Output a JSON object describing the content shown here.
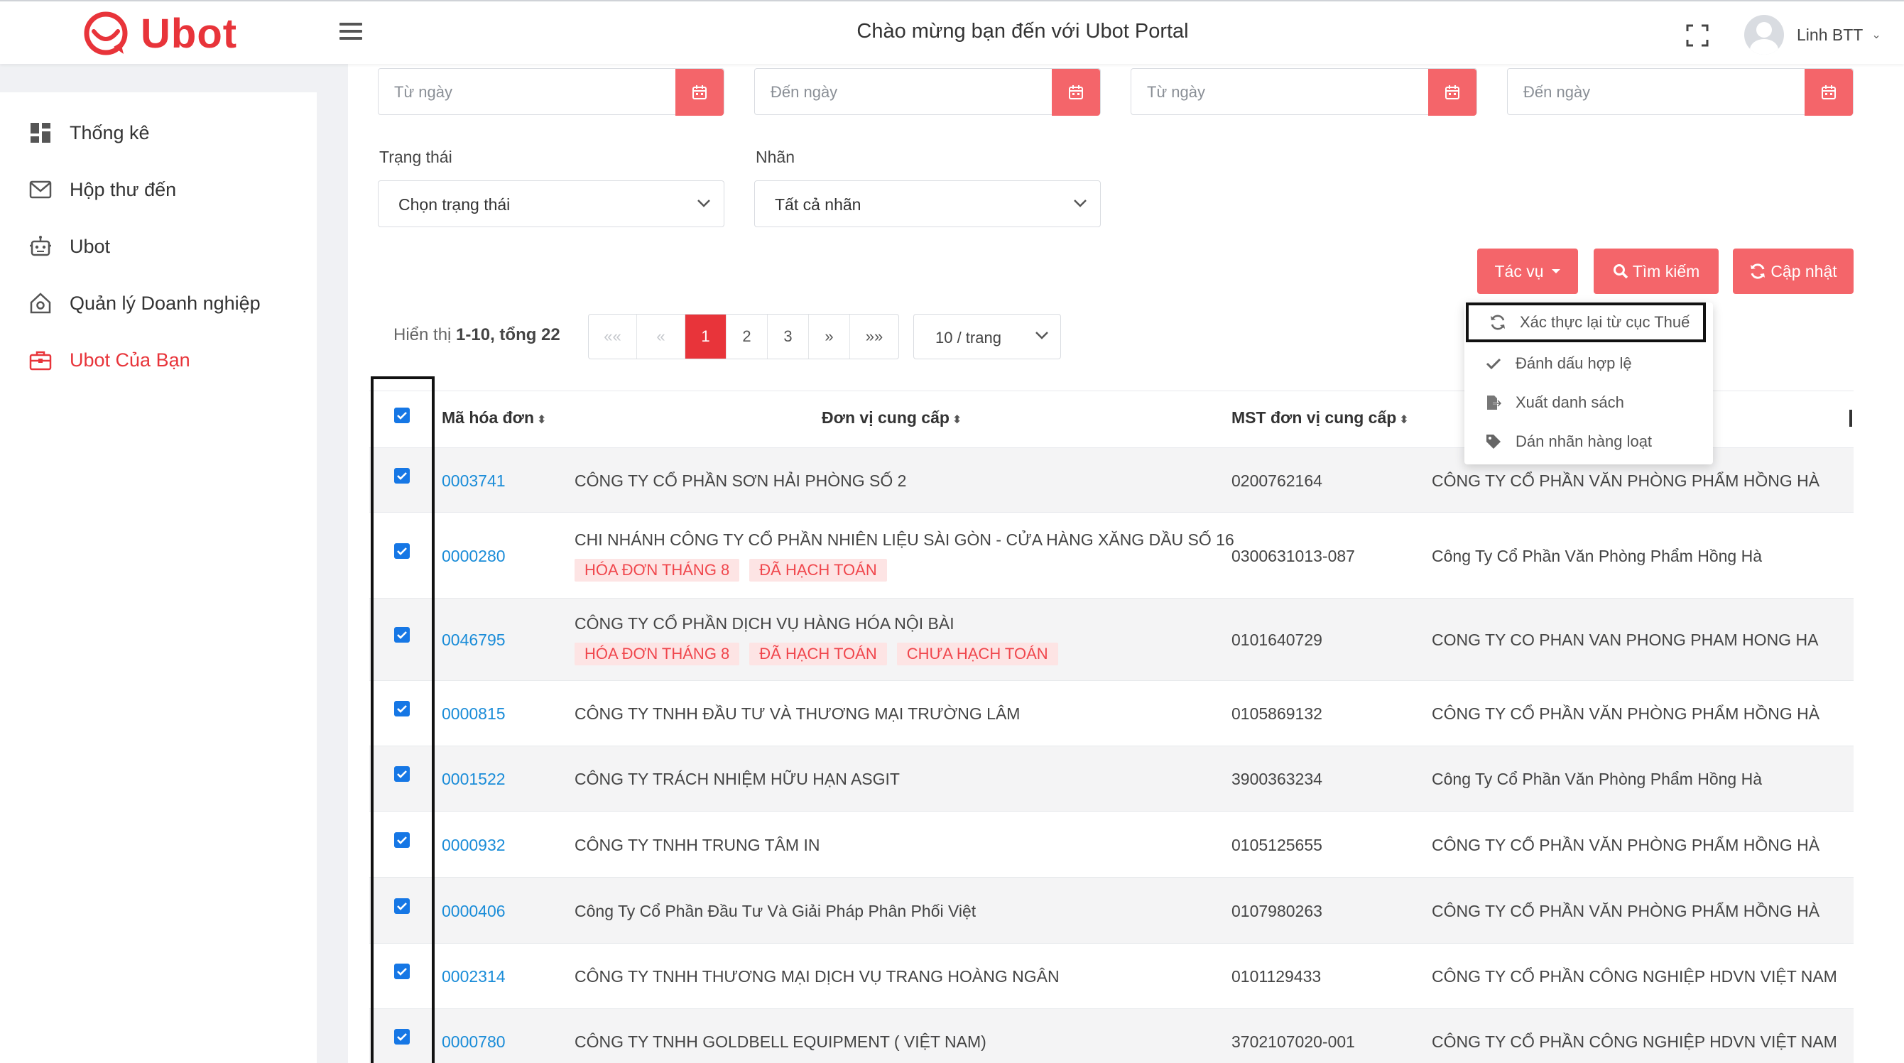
{
  "header": {
    "brand": "Ubot",
    "title": "Chào mừng bạn đến với Ubot Portal",
    "user_name": "Linh BTT",
    "user_caret": "⌄"
  },
  "sidebar": {
    "items": [
      {
        "label": "Thống kê",
        "icon": "dashboard-icon"
      },
      {
        "label": "Hộp thư đến",
        "icon": "mail-icon"
      },
      {
        "label": "Ubot",
        "icon": "robot-icon"
      },
      {
        "label": "Quản lý Doanh nghiệp",
        "icon": "building-icon"
      },
      {
        "label": "Ubot Của Bạn",
        "icon": "briefcase-icon",
        "active": true
      }
    ]
  },
  "filters": {
    "dates": [
      "Từ ngày",
      "Đến ngày",
      "Từ ngày",
      "Đến ngày"
    ],
    "status_label": "Trạng thái",
    "status_value": "Chọn trạng thái",
    "tag_label": "Nhãn",
    "tag_value": "Tất cả nhãn"
  },
  "actions": {
    "tasks": "Tác vụ",
    "search": "Tìm kiếm",
    "refresh": "Cập nhật",
    "menu": [
      {
        "label": "Xác thực lại từ cục Thuế",
        "icon": "sync-icon"
      },
      {
        "label": "Đánh dấu hợp lệ",
        "icon": "check-icon"
      },
      {
        "label": "Xuất danh sách",
        "icon": "export-icon"
      },
      {
        "label": "Dán nhãn hàng loạt",
        "icon": "tag-icon"
      }
    ]
  },
  "pagination": {
    "summary_prefix": "Hiển thị ",
    "summary_range": "1-10, tổng 22",
    "first": "««",
    "prev": "«",
    "pages": [
      "1",
      "2",
      "3"
    ],
    "current_page": "1",
    "next": "»",
    "last": "»»",
    "per_page": "10 / trang"
  },
  "table": {
    "columns": [
      "Mã hóa đơn",
      "Đơn vị cung cấp",
      "MST đơn vị cung cấp"
    ],
    "sort_glyph": "⬍",
    "rows": [
      {
        "code": "0003741",
        "supplier": "CÔNG TY CỔ PHẦN SƠN HẢI PHÒNG SỐ 2",
        "tags": [],
        "tax": "0200762164",
        "buyer": "CÔNG TY CỔ PHẦN VĂN PHÒNG PHẨM HỒNG HÀ"
      },
      {
        "code": "0000280",
        "supplier": "CHI NHÁNH CÔNG TY CỔ PHẦN NHIÊN LIỆU SÀI GÒN - CỬA HÀNG XĂNG DẦU SỐ 16",
        "tags": [
          "HÓA ĐƠN THÁNG 8",
          "ĐÃ HẠCH TOÁN"
        ],
        "tax": "0300631013-087",
        "buyer": "Công Ty Cổ Phần Văn Phòng Phẩm Hồng Hà"
      },
      {
        "code": "0046795",
        "supplier": "CÔNG TY CỔ PHẦN DỊCH VỤ HÀNG HÓA NỘI BÀI",
        "tags": [
          "HÓA ĐƠN THÁNG 8",
          "ĐÃ HẠCH TOÁN",
          "CHƯA HẠCH TOÁN"
        ],
        "tax": "0101640729",
        "buyer": "CONG TY CO PHAN VAN PHONG PHAM HONG HA"
      },
      {
        "code": "0000815",
        "supplier": "CÔNG TY TNHH ĐẦU TƯ VÀ THƯƠNG MẠI TRƯỜNG LÂM",
        "tags": [],
        "tax": "0105869132",
        "buyer": "CÔNG TY CỔ PHẦN VĂN PHÒNG PHẨM HỒNG HÀ"
      },
      {
        "code": "0001522",
        "supplier": "CÔNG TY TRÁCH NHIỆM HỮU HẠN ASGIT",
        "tags": [],
        "tax": "3900363234",
        "buyer": "Công Ty Cổ Phần Văn Phòng Phẩm Hồng Hà"
      },
      {
        "code": "0000932",
        "supplier": "CÔNG TY TNHH TRUNG TÂM IN",
        "tags": [],
        "tax": "0105125655",
        "buyer": "CÔNG TY CỔ PHẦN VĂN PHÒNG PHẨM HỒNG HÀ"
      },
      {
        "code": "0000406",
        "supplier": "Công Ty Cổ Phần Đầu Tư Và Giải Pháp Phân Phối Việt",
        "tags": [],
        "tax": "0107980263",
        "buyer": "CÔNG TY CỔ PHẦN VĂN PHÒNG PHẨM HỒNG HÀ"
      },
      {
        "code": "0002314",
        "supplier": "CÔNG TY TNHH THƯƠNG MẠI DỊCH VỤ TRANG HOÀNG NGÂN",
        "tags": [],
        "tax": "0101129433",
        "buyer": "CÔNG TY CỔ PHẦN CÔNG NGHIỆP HDVN VIỆT NAM"
      },
      {
        "code": "0000780",
        "supplier": "CÔNG TY TNHH GOLDBELL EQUIPMENT ( VIỆT NAM)",
        "tags": [],
        "tax": "3702107020-001",
        "buyer": "CÔNG TY CỔ PHẦN CÔNG NGHIỆP HDVN VIỆT NAM"
      }
    ]
  },
  "colors": {
    "accent": "#e8343a",
    "button": "#f4656a",
    "link": "#1a8cd8",
    "checkbox": "#1677e5"
  }
}
